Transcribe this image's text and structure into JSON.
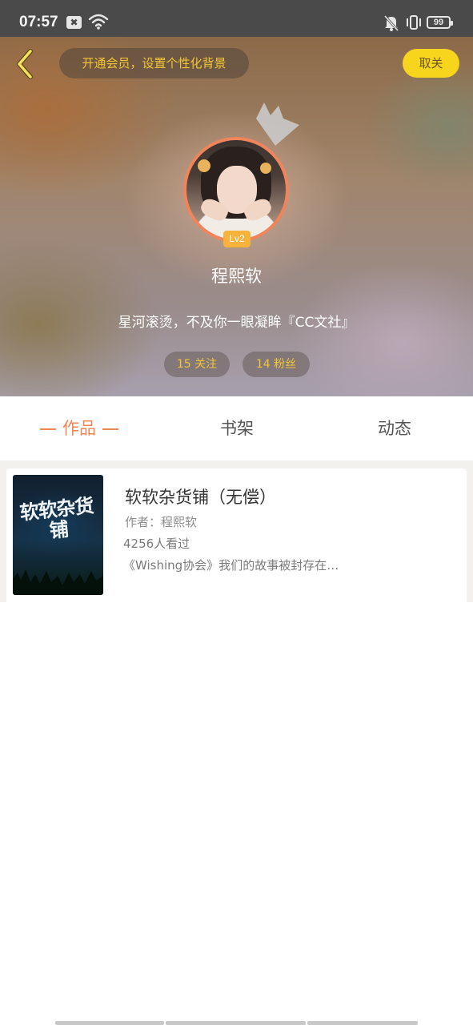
{
  "status_bar": {
    "time": "07:57",
    "battery": "99",
    "notification_glyph": "✖"
  },
  "header": {
    "vip_text": "开通会员，设置个性化背景",
    "follow_button": "取关",
    "level": "Lv2",
    "username": "程熙软",
    "bio": "星河滚烫，不及你一眼凝眸『CC文社』",
    "following": "15 关注",
    "fans": "14 粉丝"
  },
  "tabs": [
    {
      "label": "作品",
      "active": true
    },
    {
      "label": "书架",
      "active": false
    },
    {
      "label": "动态",
      "active": false
    }
  ],
  "works": [
    {
      "cover_text": "软软杂货铺",
      "title": "软软杂货铺（无偿）",
      "author": "作者：程熙软",
      "views": "4256人看过",
      "description": "《Wishing协会》我们的故事被封存在…"
    }
  ],
  "colors": {
    "accent": "#f0845a",
    "gold": "#f3c534",
    "follow_button_bg": "#f7d51d"
  }
}
